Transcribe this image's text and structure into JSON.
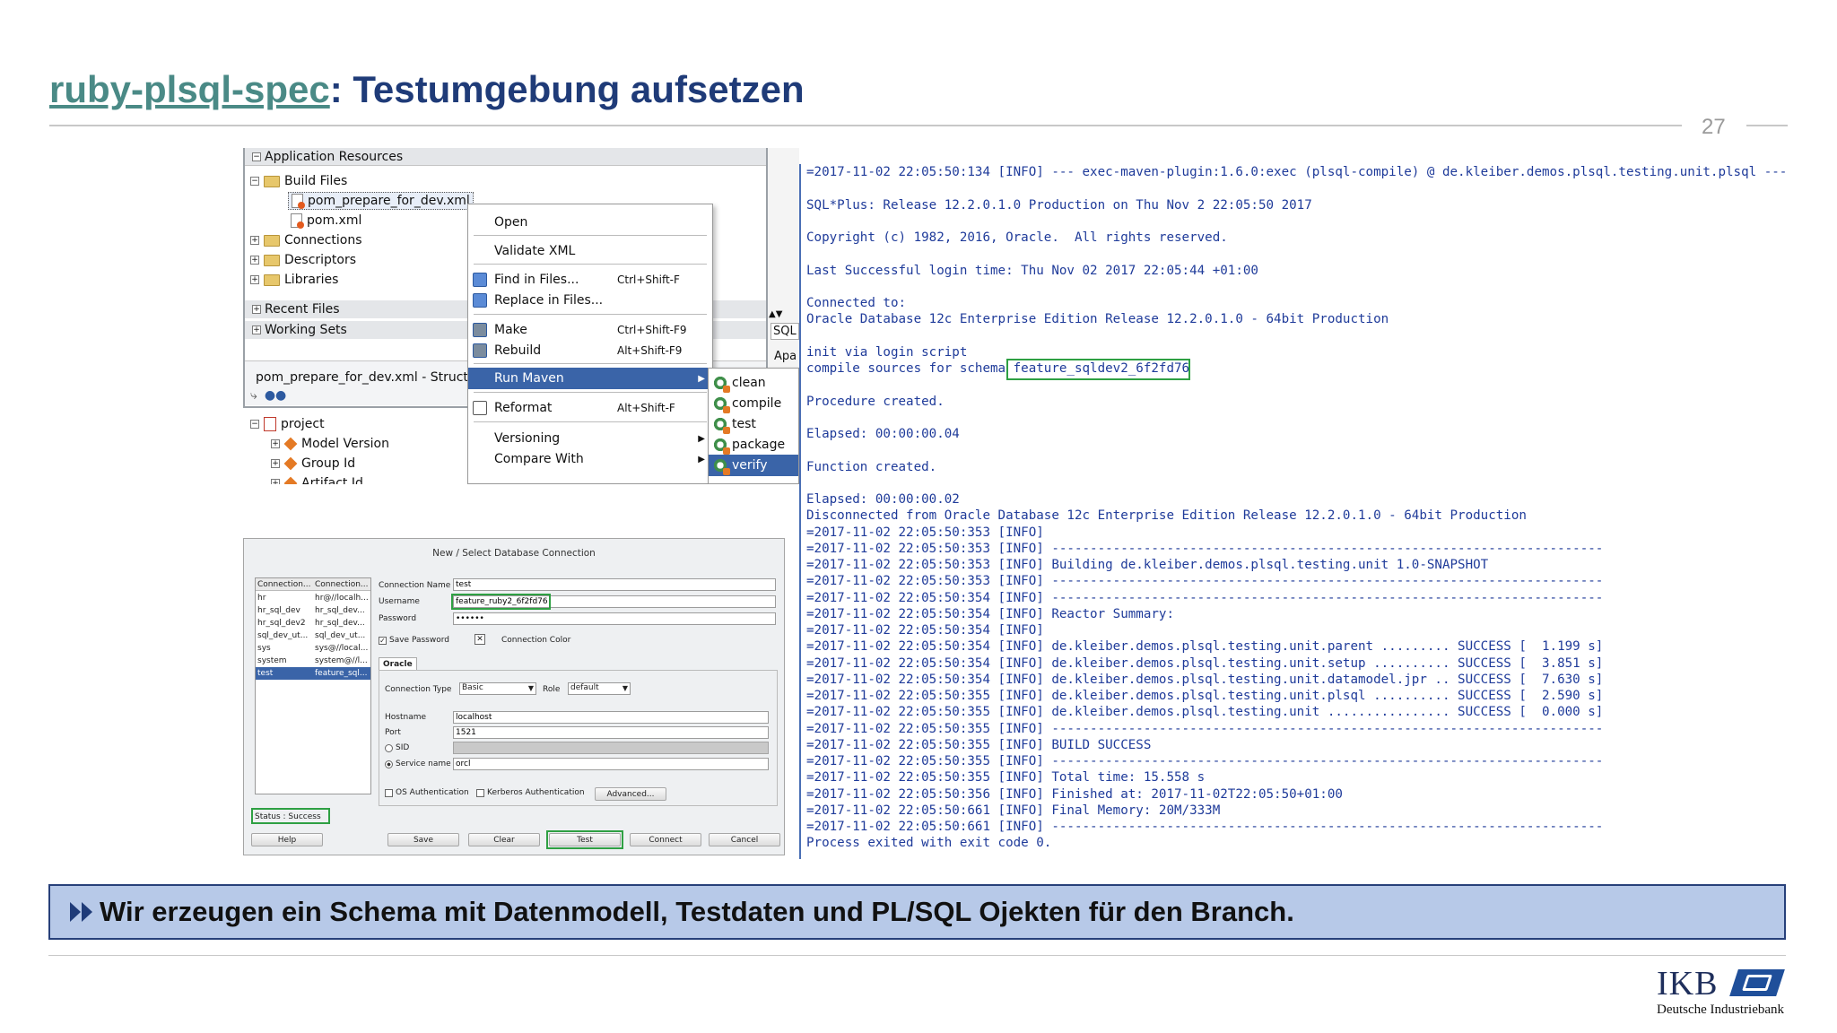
{
  "slide": {
    "title_link": "ruby-plsql-spec",
    "title_rest": ": Testumgebung aufsetzen",
    "page_number": "27",
    "banner_text": "Wir erzeugen ein Schema mit Datenmodell, Testdaten und PL/SQL Ojekten für den Branch.",
    "logo_text": "IKB",
    "logo_subtitle": "Deutsche Industriebank"
  },
  "ide": {
    "app_resources": "Application Resources",
    "build_files": "Build Files",
    "file_selected": "pom_prepare_for_dev.xml",
    "file_pom": "pom.xml",
    "connections": "Connections",
    "descriptors": "Descriptors",
    "libraries": "Libraries",
    "recent_files": "Recent Files",
    "working_sets": "Working Sets",
    "structure_title": "pom_prepare_for_dev.xml - Struct",
    "project": "project",
    "model_version": "Model Version",
    "group_id": "Group Id",
    "artifact_id": "Artifact Id",
    "side_tab_sql": "SQL",
    "side_tab_apa": "Apa"
  },
  "context_menu": {
    "open": "Open",
    "validate": "Validate XML",
    "find": "Find in Files...",
    "find_sc": "Ctrl+Shift-F",
    "replace": "Replace in Files...",
    "make": "Make",
    "make_sc": "Ctrl+Shift-F9",
    "rebuild": "Rebuild",
    "rebuild_sc": "Alt+Shift-F9",
    "run_maven": "Run Maven",
    "reformat": "Reformat",
    "reformat_sc": "Alt+Shift-F",
    "versioning": "Versioning",
    "compare": "Compare With"
  },
  "submenu": [
    "clean",
    "compile",
    "test",
    "package",
    "verify"
  ],
  "dialog": {
    "title": "New / Select Database Connection",
    "col1": "Connection...",
    "col2": "Connection...",
    "rows": [
      [
        "hr",
        "hr@//localh..."
      ],
      [
        "hr_sql_dev",
        "hr_sql_dev..."
      ],
      [
        "hr_sql_dev2",
        "hr_sql_dev..."
      ],
      [
        "sql_dev_ut...",
        "sql_dev_ut..."
      ],
      [
        "sys",
        "sys@//local..."
      ],
      [
        "system",
        "system@//l..."
      ],
      [
        "test",
        "feature_sql..."
      ]
    ],
    "status": "Status : Success",
    "conn_name_label": "Connection Name",
    "conn_name": "test",
    "username_label": "Username",
    "username": "feature_ruby2_6f2fd76",
    "password_label": "Password",
    "password": "••••••",
    "save_password": "Save Password",
    "connection_color": "Connection Color",
    "tab_oracle": "Oracle",
    "conn_type_label": "Connection Type",
    "conn_type": "Basic",
    "role_label": "Role",
    "role": "default",
    "hostname_label": "Hostname",
    "hostname": "localhost",
    "port_label": "Port",
    "port": "1521",
    "sid_label": "SID",
    "service_label": "Service name",
    "service": "orcl",
    "os_auth": "OS Authentication",
    "kerberos": "Kerberos Authentication",
    "advanced": "Advanced...",
    "btn_help": "Help",
    "btn_save": "Save",
    "btn_clear": "Clear",
    "btn_test": "Test",
    "btn_connect": "Connect",
    "btn_cancel": "Cancel"
  },
  "console": {
    "lines": [
      "=2017-11-02 22:05:50:134 [INFO] --- exec-maven-plugin:1.6.0:exec (plsql-compile) @ de.kleiber.demos.plsql.testing.unit.plsql ---",
      "",
      "SQL*Plus: Release 12.2.0.1.0 Production on Thu Nov 2 22:05:50 2017",
      "",
      "Copyright (c) 1982, 2016, Oracle.  All rights reserved.",
      "",
      "Last Successful login time: Thu Nov 02 2017 22:05:44 +01:00",
      "",
      "Connected to:",
      "Oracle Database 12c Enterprise Edition Release 12.2.0.1.0 - 64bit Production",
      "",
      "init via login script",
      "compile sources for schema feature_sqldev2_6f2fd76",
      "",
      "Procedure created.",
      "",
      "Elapsed: 00:00:00.04",
      "",
      "Function created.",
      "",
      "Elapsed: 00:00:00.02",
      "Disconnected from Oracle Database 12c Enterprise Edition Release 12.2.0.1.0 - 64bit Production",
      "=2017-11-02 22:05:50:353 [INFO]",
      "=2017-11-02 22:05:50:353 [INFO] ------------------------------------------------------------------------",
      "=2017-11-02 22:05:50:353 [INFO] Building de.kleiber.demos.plsql.testing.unit 1.0-SNAPSHOT",
      "=2017-11-02 22:05:50:353 [INFO] ------------------------------------------------------------------------",
      "=2017-11-02 22:05:50:354 [INFO] ------------------------------------------------------------------------",
      "=2017-11-02 22:05:50:354 [INFO] Reactor Summary:",
      "=2017-11-02 22:05:50:354 [INFO]",
      "=2017-11-02 22:05:50:354 [INFO] de.kleiber.demos.plsql.testing.unit.parent ......... SUCCESS [  1.199 s]",
      "=2017-11-02 22:05:50:354 [INFO] de.kleiber.demos.plsql.testing.unit.setup .......... SUCCESS [  3.851 s]",
      "=2017-11-02 22:05:50:354 [INFO] de.kleiber.demos.plsql.testing.unit.datamodel.jpr .. SUCCESS [  7.630 s]",
      "=2017-11-02 22:05:50:355 [INFO] de.kleiber.demos.plsql.testing.unit.plsql .......... SUCCESS [  2.590 s]",
      "=2017-11-02 22:05:50:355 [INFO] de.kleiber.demos.plsql.testing.unit ................ SUCCESS [  0.000 s]",
      "=2017-11-02 22:05:50:355 [INFO] ------------------------------------------------------------------------",
      "=2017-11-02 22:05:50:355 [INFO] BUILD SUCCESS",
      "=2017-11-02 22:05:50:355 [INFO] ------------------------------------------------------------------------",
      "=2017-11-02 22:05:50:355 [INFO] Total time: 15.558 s",
      "=2017-11-02 22:05:50:356 [INFO] Finished at: 2017-11-02T22:05:50+01:00",
      "=2017-11-02 22:05:50:661 [INFO] Final Memory: 20M/333M",
      "=2017-11-02 22:05:50:661 [INFO] ------------------------------------------------------------------------",
      "Process exited with exit code 0."
    ]
  },
  "colors": {
    "title_blue": "#1f3b78",
    "link_teal": "#4a8a86",
    "console_blue": "#1f3b9a",
    "highlight_green": "#2ea043",
    "banner_bg": "#b7c9e8",
    "menu_selected": "#3a64a8"
  }
}
